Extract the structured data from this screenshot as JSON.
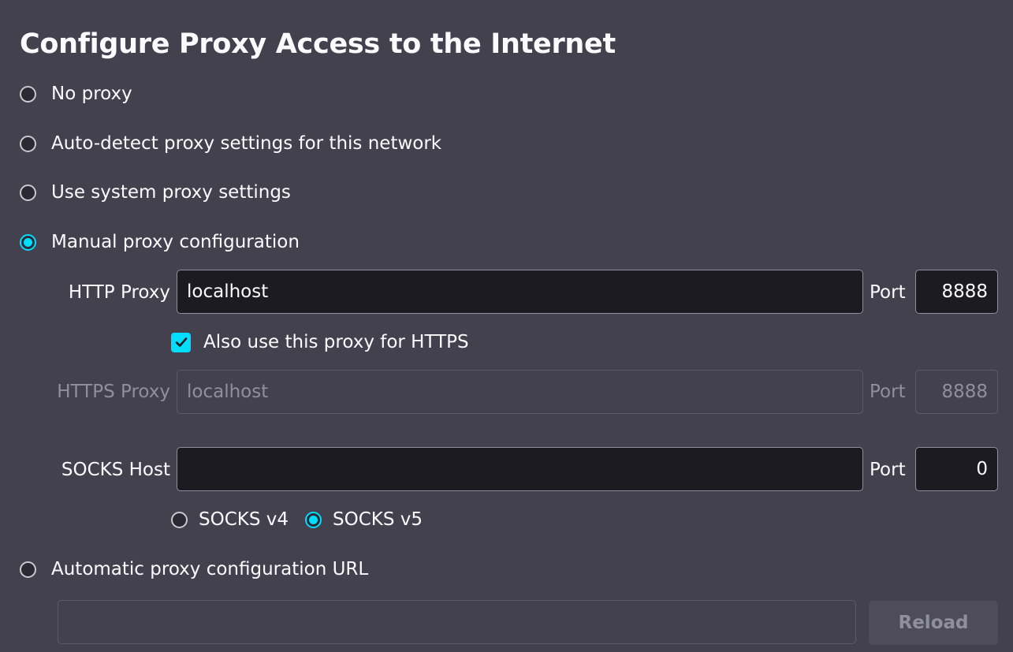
{
  "title": "Configure Proxy Access to the Internet",
  "options": {
    "no_proxy": "No proxy",
    "auto_detect": "Auto-detect proxy settings for this network",
    "system": "Use system proxy settings",
    "manual": "Manual proxy configuration",
    "auto_url": "Automatic proxy configuration URL"
  },
  "selected_option": "manual",
  "http": {
    "label": "HTTP Proxy",
    "value": "localhost",
    "port_label": "Port",
    "port_value": "8888"
  },
  "also_https": {
    "label": "Also use this proxy for HTTPS",
    "checked": true
  },
  "https": {
    "label": "HTTPS Proxy",
    "value": "localhost",
    "port_label": "Port",
    "port_value": "8888",
    "disabled": true
  },
  "socks": {
    "label": "SOCKS Host",
    "value": "",
    "port_label": "Port",
    "port_value": "0",
    "v4_label": "SOCKS v4",
    "v5_label": "SOCKS v5",
    "selected_version": "v5"
  },
  "auto_url": {
    "value": "",
    "reload_label": "Reload"
  },
  "colors": {
    "background": "#42414d",
    "accent": "#00ddff",
    "input_bg": "#1c1b22",
    "disabled_text": "#8f8f9d"
  }
}
